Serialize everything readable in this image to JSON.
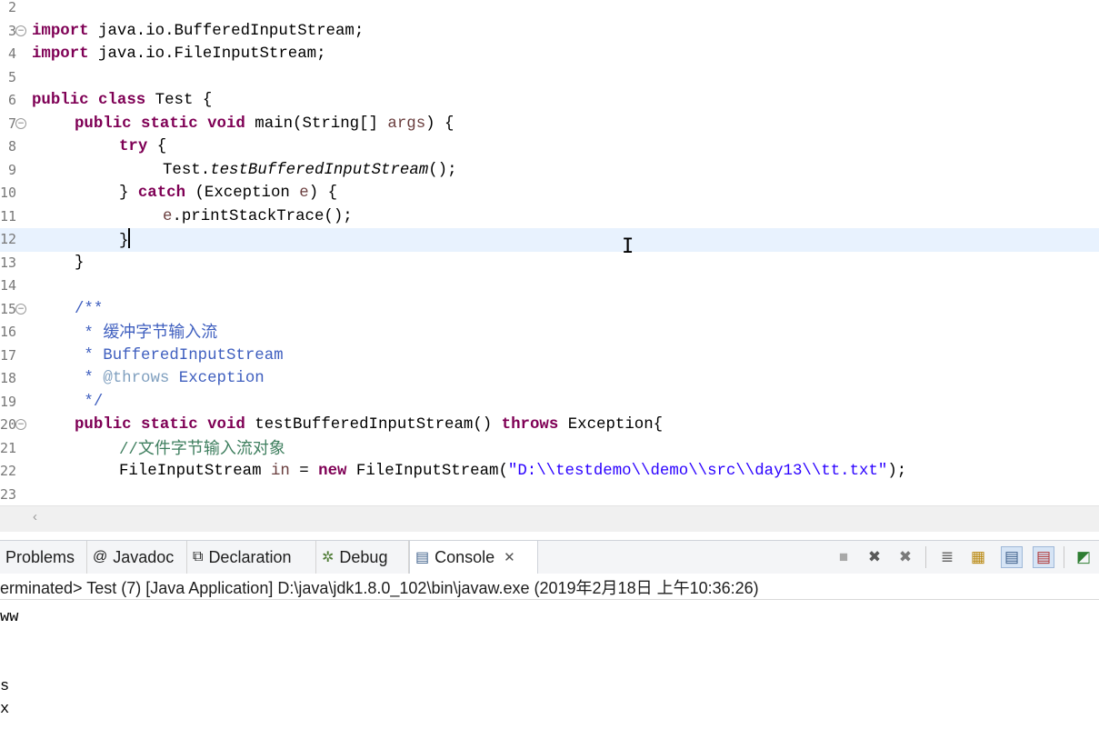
{
  "editor": {
    "lines": [
      {
        "num": "2",
        "fold": false
      },
      {
        "num": "3",
        "fold": true
      },
      {
        "num": "4",
        "fold": false
      },
      {
        "num": "5",
        "fold": false
      },
      {
        "num": "6",
        "fold": false
      },
      {
        "num": "7",
        "fold": true
      },
      {
        "num": "8",
        "fold": false
      },
      {
        "num": "9",
        "fold": false
      },
      {
        "num": "10",
        "fold": false
      },
      {
        "num": "11",
        "fold": false
      },
      {
        "num": "12",
        "fold": false
      },
      {
        "num": "13",
        "fold": false
      },
      {
        "num": "14",
        "fold": false
      },
      {
        "num": "15",
        "fold": true
      },
      {
        "num": "16",
        "fold": false
      },
      {
        "num": "17",
        "fold": false
      },
      {
        "num": "18",
        "fold": false
      },
      {
        "num": "19",
        "fold": false
      },
      {
        "num": "20",
        "fold": true
      },
      {
        "num": "21",
        "fold": false
      },
      {
        "num": "22",
        "fold": false
      },
      {
        "num": "23",
        "fold": false
      }
    ],
    "tokens": {
      "l3_kw": "import",
      "l3_rest": " java.io.BufferedInputStream;",
      "l4_kw": "import",
      "l4_rest": " java.io.FileInputStream;",
      "l6_kw": "public class",
      "l6_rest": " Test {",
      "l7_kw": "public static void",
      "l7_rest1": " main(String[] ",
      "l7_var": "args",
      "l7_rest2": ") {",
      "l8_kw": "try",
      "l8_rest": " {",
      "l9_a": "Test.",
      "l9_it": "testBufferedInputStream",
      "l9_b": "();",
      "l10_a": "} ",
      "l10_kw": "catch",
      "l10_b": " (Exception ",
      "l10_var": "e",
      "l10_c": ") {",
      "l11_var": "e",
      "l11_rest": ".printStackTrace();",
      "l12": "}",
      "l13": "}",
      "l15": "/**",
      "l16_star": " * ",
      "l16_cjk": "缓冲字节输入流",
      "l17": " * BufferedInputStream",
      "l18_star": " * ",
      "l18_tag": "@throws",
      "l18_rest": " Exception",
      "l19": " */",
      "l20_kw": "public static void",
      "l20_rest1": " testBufferedInputStream() ",
      "l20_kw2": "throws",
      "l20_rest2": " Exception{",
      "l21_slash": "//",
      "l21_cjk": "文件字节输入流对象",
      "l22_a": "FileInputStream ",
      "l22_var": "in",
      "l22_b": " = ",
      "l22_kw": "new",
      "l22_c": " FileInputStream(",
      "l22_str": "\"D:\\\\testdemo\\\\demo\\\\src\\\\day13\\\\tt.txt\"",
      "l22_d": ");"
    },
    "scroll_left_glyph": "‹",
    "ibeam_glyph": "I"
  },
  "tabs": [
    {
      "label": "Problems",
      "icon": "problems-icon",
      "glyph": ""
    },
    {
      "label": "Javadoc",
      "icon": "javadoc-icon",
      "glyph": "@"
    },
    {
      "label": "Declaration",
      "icon": "declaration-icon",
      "glyph": "⧉"
    },
    {
      "label": "Debug",
      "icon": "debug-icon",
      "glyph": "✲"
    },
    {
      "label": "Console",
      "icon": "console-icon",
      "glyph": "▤",
      "close": "✕"
    }
  ],
  "toolbar": {
    "terminate": "■",
    "remove_launch": "✖",
    "remove_all": "✖",
    "scroll_lock": "≣",
    "pin": "▦",
    "display_selected": "▤",
    "open_console": "▤",
    "new_console": "◩"
  },
  "console": {
    "status": "erminated> Test (7) [Java Application] D:\\java\\jdk1.8.0_102\\bin\\javaw.exe (2019年2月18日 上午10:36:26)",
    "output": [
      "ww",
      "",
      "",
      "s",
      "x"
    ]
  }
}
